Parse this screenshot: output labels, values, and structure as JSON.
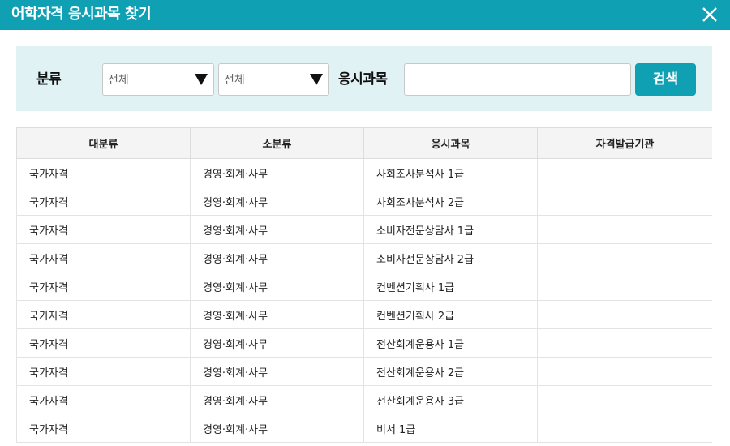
{
  "dialog": {
    "title": "어학자격 응시과목 찾기",
    "close_icon": "close-icon"
  },
  "search": {
    "category_label": "분류",
    "major_select_value": "전체",
    "minor_select_value": "전체",
    "subject_label": "응시과목",
    "subject_input_value": "",
    "search_button_label": "검색"
  },
  "table": {
    "headers": [
      "대분류",
      "소분류",
      "응시과목",
      "자격발급기관"
    ],
    "rows": [
      [
        "국가자격",
        "경영·회계·사무",
        "사회조사분석사 1급",
        ""
      ],
      [
        "국가자격",
        "경영·회계·사무",
        "사회조사분석사 2급",
        ""
      ],
      [
        "국가자격",
        "경영·회계·사무",
        "소비자전문상담사 1급",
        ""
      ],
      [
        "국가자격",
        "경영·회계·사무",
        "소비자전문상담사 2급",
        ""
      ],
      [
        "국가자격",
        "경영·회계·사무",
        "컨벤션기획사 1급",
        ""
      ],
      [
        "국가자격",
        "경영·회계·사무",
        "컨벤션기획사 2급",
        ""
      ],
      [
        "국가자격",
        "경영·회계·사무",
        "전산회계운용사 1급",
        ""
      ],
      [
        "국가자격",
        "경영·회계·사무",
        "전산회계운용사 2급",
        ""
      ],
      [
        "국가자격",
        "경영·회계·사무",
        "전산회계운용사 3급",
        ""
      ],
      [
        "국가자격",
        "경영·회계·사무",
        "비서 1급",
        ""
      ]
    ]
  },
  "colors": {
    "accent": "#0fa0b4",
    "panel_bg": "#e1f2f5",
    "header_bg": "#f4f4f4"
  }
}
